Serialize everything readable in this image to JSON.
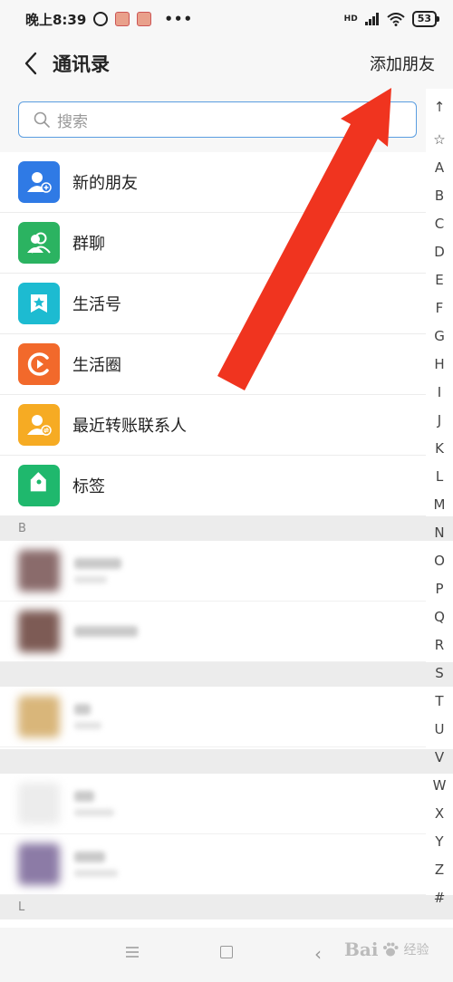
{
  "status_bar": {
    "time": "晚上8:39",
    "network": "HD",
    "battery": "53"
  },
  "nav": {
    "title": "通讯录",
    "action": "添加朋友"
  },
  "search": {
    "placeholder": "搜索"
  },
  "menu": [
    {
      "label": "新的朋友",
      "icon": "person-add-icon",
      "color": "#2f7ae5"
    },
    {
      "label": "群聊",
      "icon": "group-icon",
      "color": "#2bb361"
    },
    {
      "label": "生活号",
      "icon": "star-badge-icon",
      "color": "#1dbbd1"
    },
    {
      "label": "生活圈",
      "icon": "circle-play-icon",
      "color": "#f2692b"
    },
    {
      "label": "最近转账联系人",
      "icon": "person-transfer-icon",
      "color": "#f6ab23"
    },
    {
      "label": "标签",
      "icon": "tag-icon",
      "color": "#1fb86d"
    }
  ],
  "sections": [
    "B",
    "L"
  ],
  "index": [
    "↑",
    "☆",
    "A",
    "B",
    "C",
    "D",
    "E",
    "F",
    "G",
    "H",
    "I",
    "J",
    "K",
    "L",
    "M",
    "N",
    "O",
    "P",
    "Q",
    "R",
    "S",
    "T",
    "U",
    "V",
    "W",
    "X",
    "Y",
    "Z",
    "#"
  ],
  "watermark": {
    "brand": "Bai",
    "suffix": "经验"
  },
  "colors": {
    "accent": "#5a9de0",
    "arrow": "#f0341f"
  }
}
